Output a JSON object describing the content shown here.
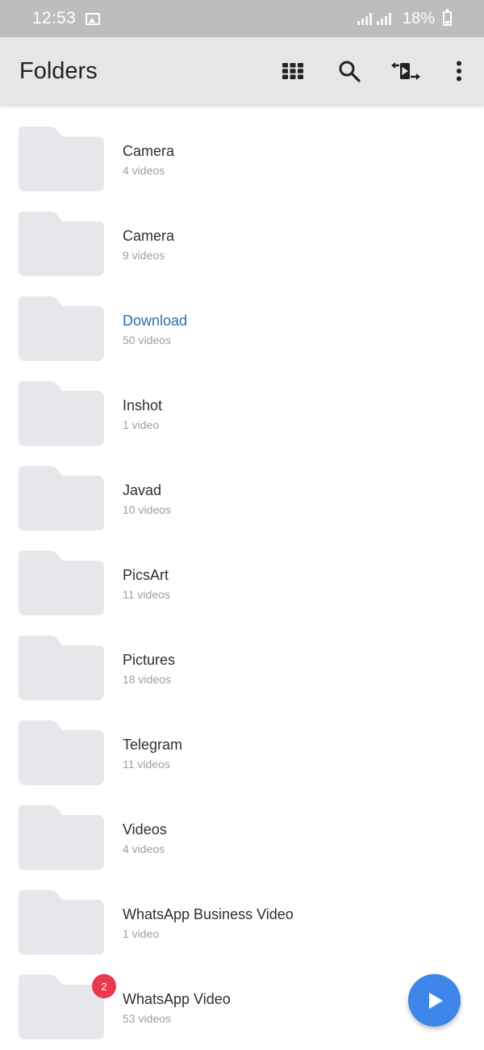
{
  "status_bar": {
    "time": "12:53",
    "battery_percent": "18%",
    "icons": [
      "gallery-icon",
      "signal-icon",
      "signal-icon",
      "battery-icon"
    ]
  },
  "app_bar": {
    "title": "Folders",
    "actions": [
      "grid-view-icon",
      "search-icon",
      "swap-media-icon",
      "more-vert-icon"
    ]
  },
  "folders": [
    {
      "name": "Camera",
      "count": "4 videos",
      "highlighted": false
    },
    {
      "name": "Camera",
      "count": "9 videos",
      "highlighted": false
    },
    {
      "name": "Download",
      "count": "50 videos",
      "highlighted": true
    },
    {
      "name": "Inshot",
      "count": "1 video",
      "highlighted": false
    },
    {
      "name": "Javad",
      "count": "10 videos",
      "highlighted": false
    },
    {
      "name": "PicsArt",
      "count": "11 videos",
      "highlighted": false
    },
    {
      "name": "Pictures",
      "count": "18 videos",
      "highlighted": false
    },
    {
      "name": "Telegram",
      "count": "11 videos",
      "highlighted": false
    },
    {
      "name": "Videos",
      "count": "4 videos",
      "highlighted": false
    },
    {
      "name": "WhatsApp Business Video",
      "count": "1 video",
      "highlighted": false
    },
    {
      "name": "WhatsApp Video",
      "count": "53 videos",
      "highlighted": false,
      "badge": "2"
    }
  ],
  "fab": {
    "icon": "play-icon"
  },
  "colors": {
    "accent": "#3f86ea",
    "highlight_text": "#2d6fa8",
    "badge": "#e8394f",
    "folder": "#e5e7ea",
    "app_bar": "#e6e6e6",
    "status_bar": "#bdbdbd"
  }
}
